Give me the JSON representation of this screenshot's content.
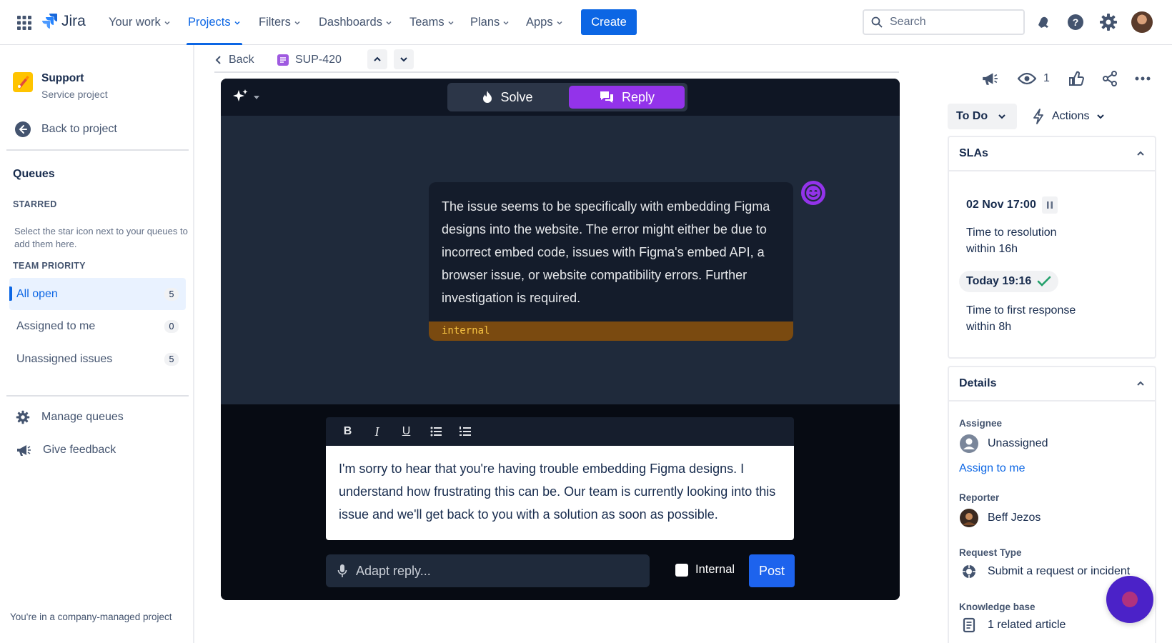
{
  "nav": {
    "app_name": "Jira",
    "items": [
      {
        "label": "Your work"
      },
      {
        "label": "Projects"
      },
      {
        "label": "Filters"
      },
      {
        "label": "Dashboards"
      },
      {
        "label": "Teams"
      },
      {
        "label": "Plans"
      },
      {
        "label": "Apps"
      }
    ],
    "active_item": "Projects",
    "create_label": "Create",
    "search_placeholder": "Search",
    "accent_color": "#0c66e4"
  },
  "sidebar": {
    "project_name": "Support",
    "project_type": "Service project",
    "back_label": "Back to project",
    "queues_heading": "Queues",
    "starred_label": "STARRED",
    "starred_desc": "Select the star icon next to your queues to add them here.",
    "team_priority_label": "TEAM PRIORITY",
    "queues": [
      {
        "label": "All open",
        "count": "5",
        "selected": true
      },
      {
        "label": "Assigned to me",
        "count": "0",
        "selected": false
      },
      {
        "label": "Unassigned issues",
        "count": "5",
        "selected": false
      }
    ],
    "manage_label": "Manage queues",
    "feedback_label": "Give feedback",
    "footer": "You're in a company-managed project"
  },
  "breadcrumb": {
    "back_label": "Back",
    "issue_key": "SUP-420"
  },
  "ai_panel": {
    "solve_label": "Solve",
    "reply_label": "Reply",
    "active_tab": "Reply",
    "message": "The issue seems to be specifically with embedding Figma designs into the website. The error might either be due to incorrect embed code, issues with Figma's embed API, a browser issue, or website compatibility errors. Further investigation is required.",
    "message_tag": "internal",
    "reply_text": "I'm sorry to hear that you're having trouble embedding Figma designs. I understand how frustrating this can be. Our team is currently looking into this issue and we'll get back to you with a solution as soon as possible.",
    "adapt_placeholder": "Adapt reply...",
    "internal_label": "Internal",
    "internal_checked": false,
    "post_label": "Post",
    "reply_accent": "#9333ea"
  },
  "issue_side": {
    "watchers": "1",
    "status": "To Do",
    "actions_label": "Actions",
    "slas": {
      "heading": "SLAs",
      "items": [
        {
          "date": "02 Nov 17:00",
          "label": "Time to resolution",
          "within": "within 16h",
          "state": "paused"
        },
        {
          "date": "Today 19:16",
          "label": "Time to first response",
          "within": "within 8h",
          "state": "met"
        }
      ]
    },
    "details": {
      "heading": "Details",
      "assignee_label": "Assignee",
      "assignee": "Unassigned",
      "assign_link": "Assign to me",
      "reporter_label": "Reporter",
      "reporter": "Beff Jezos",
      "request_type_label": "Request Type",
      "request_type": "Submit a request or incident",
      "kb_label": "Knowledge base",
      "kb_value": "1 related article"
    }
  }
}
